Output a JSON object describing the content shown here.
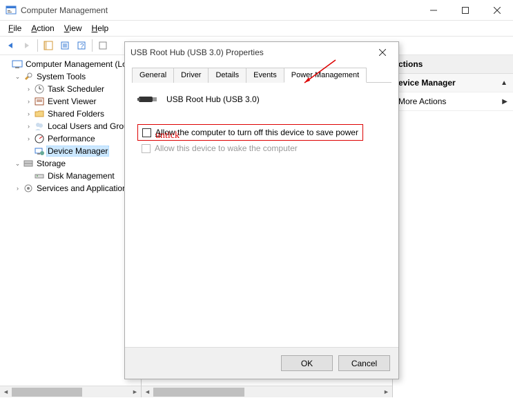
{
  "window": {
    "title": "Computer Management"
  },
  "menu": {
    "file": "File",
    "action": "Action",
    "view": "View",
    "help": "Help"
  },
  "tree": {
    "root": "Computer Management (Lo",
    "system_tools": "System Tools",
    "task_scheduler": "Task Scheduler",
    "event_viewer": "Event Viewer",
    "shared_folders": "Shared Folders",
    "local_users": "Local Users and Grou",
    "performance": "Performance",
    "device_manager": "Device Manager",
    "storage": "Storage",
    "disk_management": "Disk Management",
    "services_apps": "Services and Application"
  },
  "actions_pane": {
    "header": "ctions",
    "item1": "evice Manager",
    "item2": "More Actions"
  },
  "dialog": {
    "title": "USB Root Hub (USB 3.0) Properties",
    "tabs": {
      "general": "General",
      "driver": "Driver",
      "details": "Details",
      "events": "Events",
      "power_mgmt": "Power Management"
    },
    "device_name": "USB Root Hub (USB 3.0)",
    "chk_allow_off": "Allow the computer to turn off this device to save power",
    "chk_allow_wake": "Allow this device to wake the computer",
    "ok": "OK",
    "cancel": "Cancel"
  },
  "annotations": {
    "untick": "untick"
  }
}
